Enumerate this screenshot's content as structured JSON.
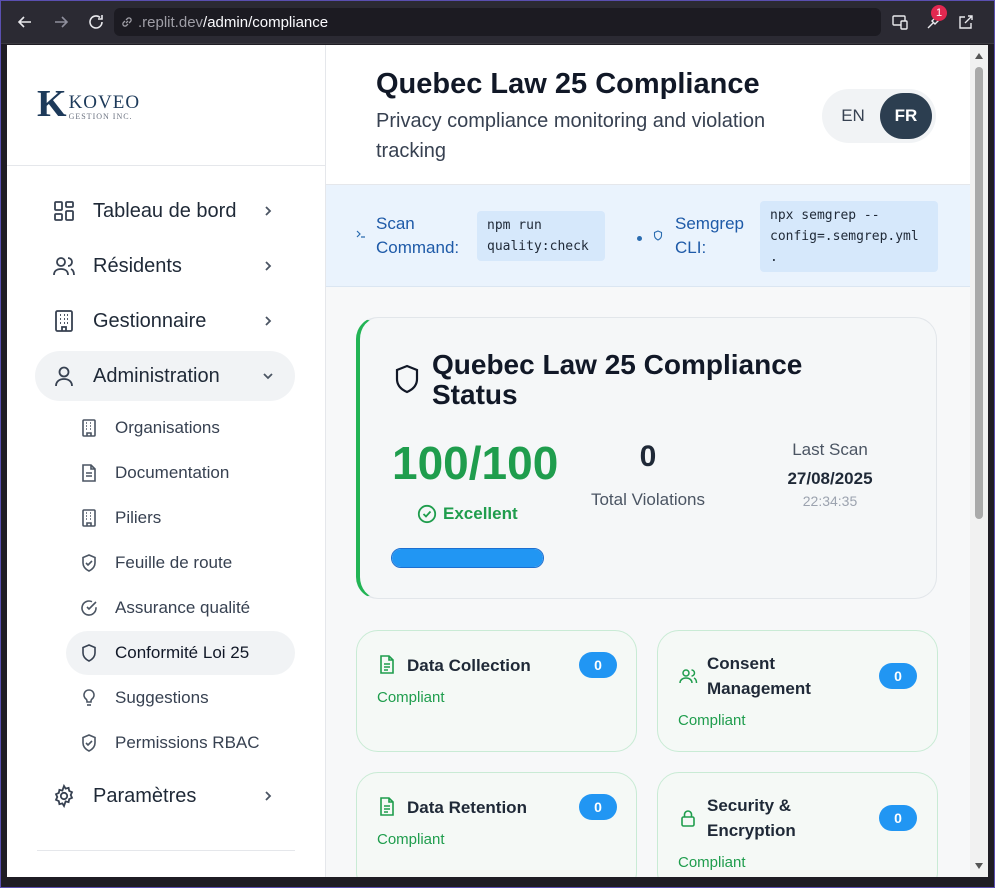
{
  "browser": {
    "url_prefix": ".replit.dev",
    "url_path": "/admin/compliance",
    "extensions_badge": "1"
  },
  "logo": {
    "letter": "K",
    "name": "KOVEO",
    "sub": "GESTION INC."
  },
  "sidebar": {
    "items": [
      {
        "label": "Tableau de bord",
        "icon": "dashboard-icon"
      },
      {
        "label": "Résidents",
        "icon": "users-icon"
      },
      {
        "label": "Gestionnaire",
        "icon": "building-icon"
      },
      {
        "label": "Administration",
        "icon": "user-icon"
      },
      {
        "label": "Paramètres",
        "icon": "gear-icon"
      }
    ],
    "sub_items": [
      {
        "label": "Organisations",
        "icon": "building-icon"
      },
      {
        "label": "Documentation",
        "icon": "document-icon"
      },
      {
        "label": "Piliers",
        "icon": "building-icon"
      },
      {
        "label": "Feuille de route",
        "icon": "shield-check-icon"
      },
      {
        "label": "Assurance qualité",
        "icon": "check-circle-icon"
      },
      {
        "label": "Conformité Loi 25",
        "icon": "shield-icon"
      },
      {
        "label": "Suggestions",
        "icon": "lightbulb-icon"
      },
      {
        "label": "Permissions RBAC",
        "icon": "shield-check-icon"
      }
    ]
  },
  "header": {
    "title": "Quebec Law 25 Compliance",
    "subtitle": "Privacy compliance monitoring and violation tracking",
    "lang_en": "EN",
    "lang_fr": "FR"
  },
  "commands": {
    "scan_label": "Scan Command:",
    "scan_code": "npm run quality:check",
    "semgrep_label": "Semgrep CLI:",
    "semgrep_code": "npx semgrep --config=.semgrep.yml ."
  },
  "status": {
    "title": "Quebec Law 25 Compliance Status",
    "score": "100/100",
    "rating": "Excellent",
    "progress_fraction": 1.0,
    "violations_count": "0",
    "violations_label": "Total Violations",
    "last_scan_label": "Last Scan",
    "last_scan_date": "27/08/2025",
    "last_scan_time": "22:34:35"
  },
  "categories": [
    {
      "title": "Data Collection",
      "count": "0",
      "status": "Compliant",
      "icon": "document-icon"
    },
    {
      "title": "Consent Management",
      "count": "0",
      "status": "Compliant",
      "icon": "users-icon"
    },
    {
      "title": "Data Retention",
      "count": "0",
      "status": "Compliant",
      "icon": "document-icon"
    },
    {
      "title": "Security & Encryption",
      "count": "0",
      "status": "Compliant",
      "icon": "lock-icon"
    }
  ],
  "colors": {
    "accent_green": "#1f9d4d",
    "accent_blue": "#2196f3",
    "lang_active": "#2c3e50"
  }
}
